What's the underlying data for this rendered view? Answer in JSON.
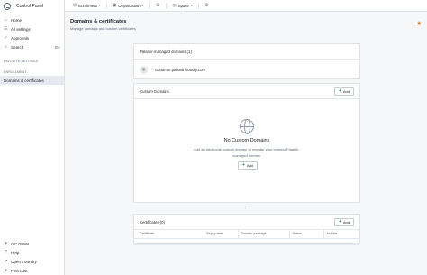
{
  "app": {
    "title": "Control Panel"
  },
  "sidebar": {
    "items": [
      {
        "label": "Home",
        "icon": "home-icon"
      },
      {
        "label": "All settings",
        "icon": "settings-icon"
      },
      {
        "label": "Approvals",
        "icon": "check-icon"
      },
      {
        "label": "Search",
        "icon": "search-icon",
        "shortcut": "⌘K"
      }
    ],
    "sections": [
      {
        "title": "FAVORITE SETTINGS"
      },
      {
        "title": "ENROLLMENT"
      }
    ],
    "enrollment_items": [
      {
        "label": "Domains & certificates",
        "active": true
      }
    ],
    "bottom_items": [
      {
        "label": "AIP Assist",
        "icon": "aip-assist-icon"
      },
      {
        "label": "Help",
        "icon": "help-icon"
      },
      {
        "label": "Open Foundry",
        "icon": "open-foundry-icon"
      },
      {
        "label": "First Last",
        "icon": "user-icon"
      }
    ]
  },
  "topbar": {
    "enrollment_label": "Enrollment",
    "organization_label": "Organization",
    "space_label": "Space"
  },
  "page": {
    "title": "Domains & certificates",
    "subtitle": "Manage domains and custom certificates"
  },
  "managed_domains": {
    "title": "Palantir-managed domains (1)",
    "domain": "customer.palantirfoundry.com"
  },
  "custom_domains": {
    "title": "Custom Domains",
    "add_label": "Add",
    "empty_title": "No Custom Domains",
    "empty_desc": "Add an additional custom domain or migrate your existing Palantir-managed domain.",
    "empty_add_label": "Add"
  },
  "certificates": {
    "title": "Certificates (0)",
    "add_label": "Add",
    "columns": [
      "Certificate",
      "Expiry date",
      "Domain coverage",
      "Status",
      "Actions"
    ]
  },
  "colors": {
    "accent_green": "#238551",
    "star": "#c87619",
    "active_bg": "#e6eaf0"
  }
}
